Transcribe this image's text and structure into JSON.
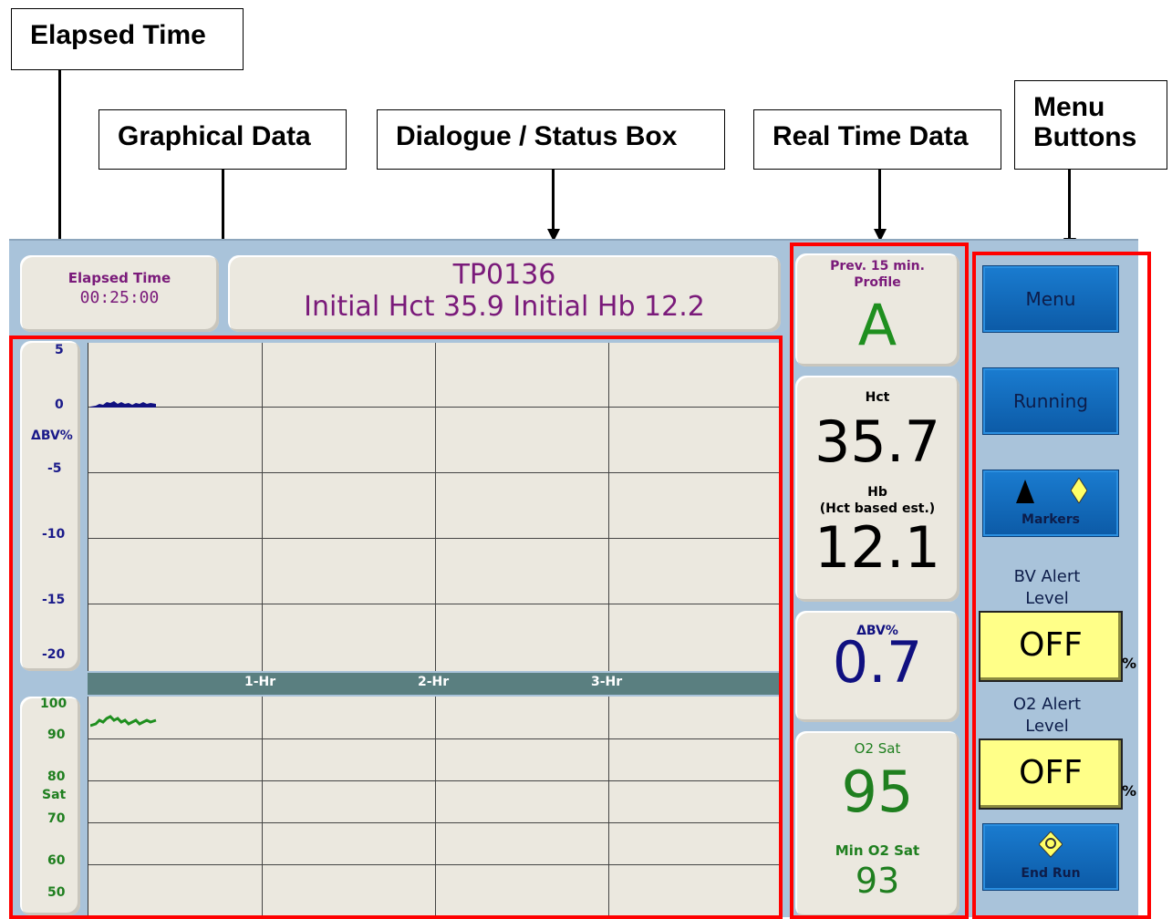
{
  "callouts": {
    "elapsed_time": "Elapsed Time",
    "graphical_data": "Graphical Data",
    "dialogue_status": "Dialogue / Status Box",
    "real_time_data": "Real Time Data",
    "menu_buttons_line1": "Menu",
    "menu_buttons_line2": "Buttons"
  },
  "elapsed": {
    "label": "Elapsed Time",
    "value": "00:25:00"
  },
  "status": {
    "line1": "TP0136",
    "line2": "Initial Hct 35.9 Initial Hb 12.2"
  },
  "graph": {
    "bv_ticks": [
      "5",
      "0",
      "-5",
      "-10",
      "-15",
      "-20"
    ],
    "bv_axis_label": "ΔBV%",
    "time_labels": [
      "1-Hr",
      "2-Hr",
      "3-Hr"
    ],
    "sat_ticks": [
      "100",
      "90",
      "80",
      "70",
      "60",
      "50"
    ],
    "sat_axis_label": "Sat"
  },
  "realtime": {
    "profile_label_line1": "Prev. 15 min.",
    "profile_label_line2": "Profile",
    "profile_value": "A",
    "hct_label": "Hct",
    "hct_value": "35.7",
    "hb_label_line1": "Hb",
    "hb_label_line2": "(Hct based est.)",
    "hb_value": "12.1",
    "dbv_label": "ΔBV%",
    "dbv_value": "0.7",
    "o2_label": "O2 Sat",
    "o2_value": "95",
    "min_o2_label": "Min O2 Sat",
    "min_o2_value": "93"
  },
  "menu": {
    "menu_label": "Menu",
    "running_label": "Running",
    "markers_label": "Markers",
    "bv_alert_line1": "BV Alert",
    "bv_alert_line2": "Level",
    "bv_alert_value": "OFF",
    "o2_alert_line1": "O2 Alert",
    "o2_alert_line2": "Level",
    "o2_alert_value": "OFF",
    "percent": "%",
    "end_run_label": "End Run"
  },
  "colors": {
    "screen_bg": "#a9c3da",
    "panel_bg": "#ebe8df",
    "highlight_red": "#ff0000",
    "button_blue": "#1a7cd0",
    "alert_yellow": "#ffff88"
  }
}
